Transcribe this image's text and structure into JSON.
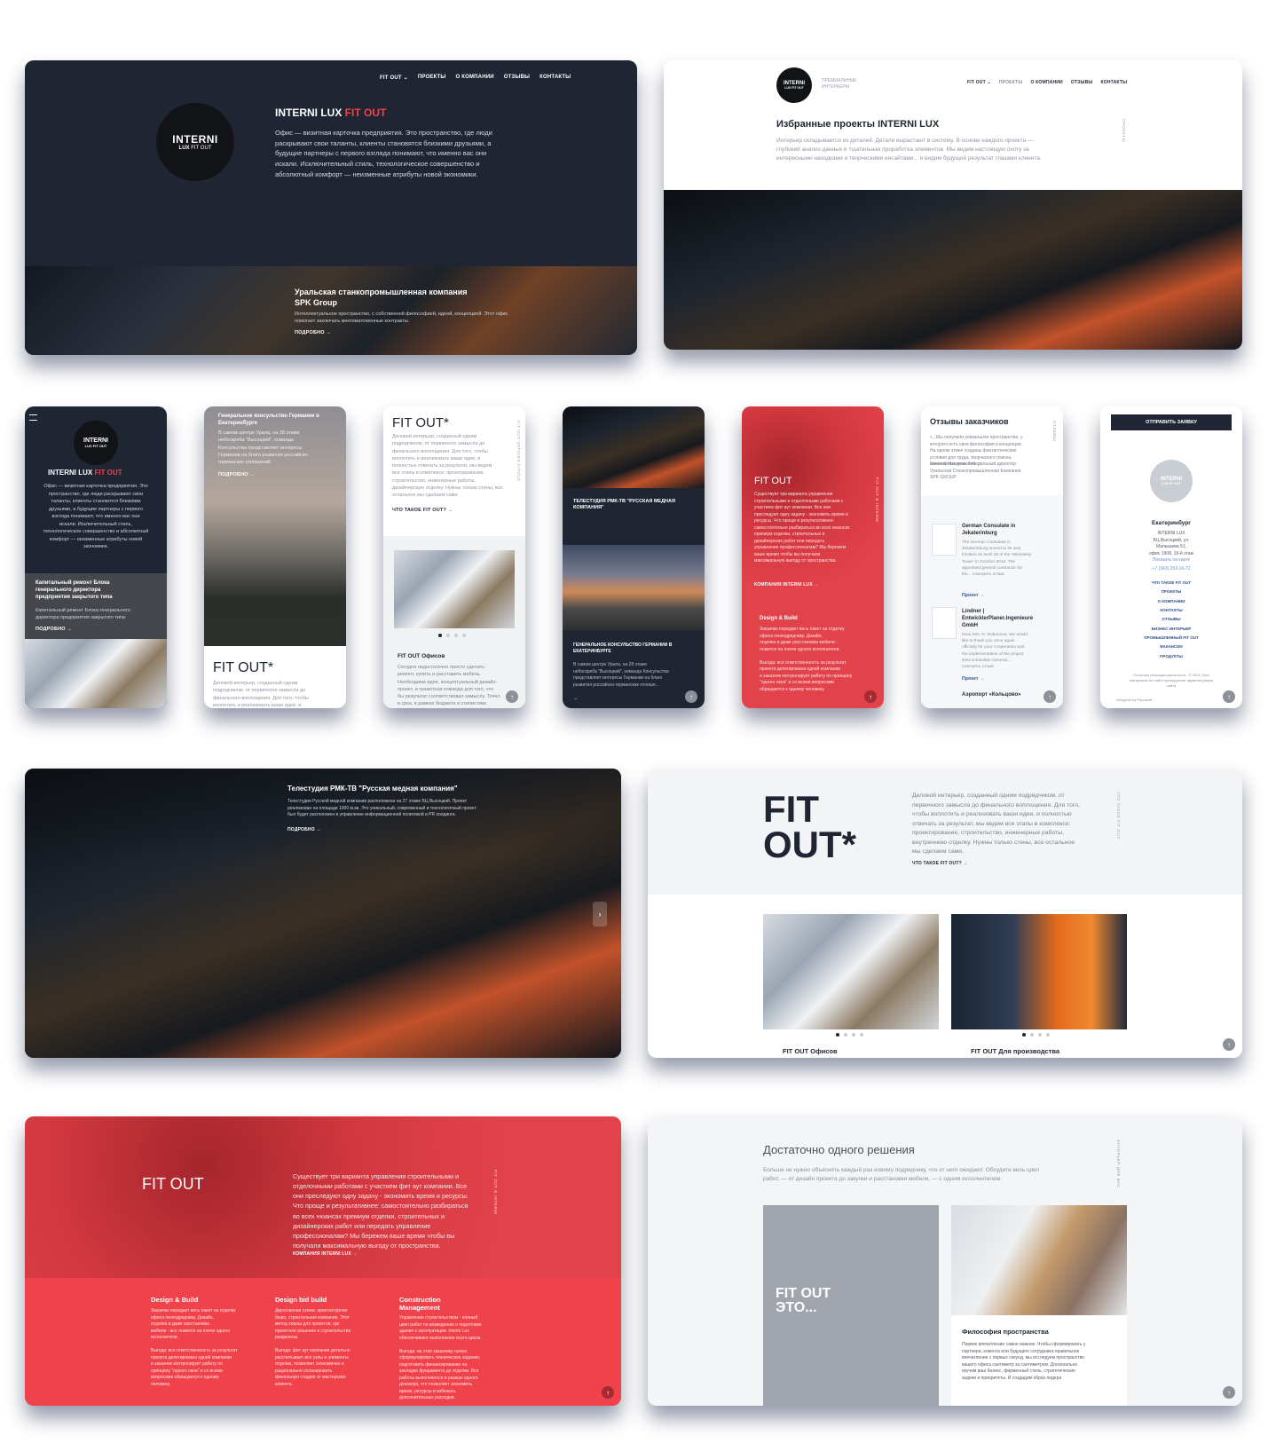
{
  "colors": {
    "navy": "#1f2533",
    "red": "#f0424b",
    "accent_red": "#e2434b"
  },
  "nav": {
    "fitout": "FIT OUT ⌄",
    "projects": "ПРОЕКТЫ",
    "company": "О КОМПАНИИ",
    "reviews": "ОТЗЫВЫ",
    "contacts": "КОНТАКТЫ",
    "fitout_plain": "FIT OUT ⌄"
  },
  "logo": {
    "top": "INTERNI",
    "bottom_lux": "LUX",
    "bottom_fit": "FIT OUT",
    "tagline": "ПРЕМИАЛЬНЫЕ\nИНТЕРЬЕРЫ"
  },
  "hero": {
    "title_white": "INTERNI LUX ",
    "title_red": "FIT OUT",
    "text": "Офис — визитная карточка предприятия. Это пространство, где люди\nраскрывают свои таланты, клиенты становятся близкими друзьями, а\nбудущие партнеры с первого взгляда понимают, что именно вас они\nискали. Исключительный стиль, технологическое совершенство и\nабсолютный комфорт — неизменные атрибуты новой экономики.",
    "slide_title": "Уральская станкопромышленная компания\nSPK Group",
    "slide_text": "Интеллектуальное пространство, с собственной философией, идеей, концепцией. Этот офис\nпомогает заключать многомиллионные контракты.",
    "slide_more": "ПОДРОБНО →"
  },
  "projects": {
    "title": "Избранные проекты INTERNI LUX",
    "text": "Интерьер складывается из деталей. Детали вырастают в систему. В основе каждого проекта —\nглубокий анализ данных и тщательная проработка элементов. Мы ведем настоящую охоту за\nинтересными находками и творческими инсайтами... и видим будущий результат глазами клиента.",
    "vert": "ПРОЕКТЫ"
  },
  "m1": {
    "title_white": "INTERNI LUX ",
    "title_red": "FIT OUT",
    "text": "Офис — визитная карточка предприятия. Это\nпространство, где люди раскрывают свои\nталанты, клиенты становятся близкими\nдрузьями, а будущие партнеры с первого\nвзгляда понимают, что именно вас они\nискали. Исключительный стиль,\nтехнологическое совершенство и абсолютный\nкомфорт — неизменные атрибуты новой\nэкономики.",
    "slide_title": "Капитальный ремонт Блока\nгенерального директора\nпредприятия закрытого типа",
    "slide_text": "Капитальный ремонт Блока генерального\nдиректора предприятия закрытого типа",
    "more": "ПОДРОБНО →"
  },
  "m2": {
    "title": "Генеральное консульство Германии в\nЕкатеринбурге",
    "text": "В самом центре Урала, на 28 этаже\nнебоскреба \"Высоцкий\", команда\nКонсульства представляет интересы\nГермании на благо развития российско-\nгерманских отношений.",
    "more": "ПОДРОБНО →",
    "big": "FIT OUT*",
    "bottom_text": "Деловой интерьер, созданный одним\nподрядчиком, от первичного замысла до\nфинального воплощения. Для того, чтобы\nвоплотить и реализовать ваши идеи, и"
  },
  "m3": {
    "big": "FIT OUT*",
    "text": "Деловой интерьер, созданный одним\nподрядчиком, от первичного замысла до\nфинального воплощения. Для того, чтобы\nвоплотить и реализовать ваши идеи, и\nполностью отвечать за результат, мы ведем\nвсе этапы в комплексе: проектирование,\nстроительство, инженерные работы,\nдизайнерскую отделку. Нужны только стены, все\nостальное мы сделаем сами.",
    "more": "ЧТО ТАКОЕ FIT OUT? →",
    "card_title": "FIT OUT Офисов",
    "card_text": "Сегодня недостаточно просто сделать\nремонт, купить и расставить мебель.\nНеобходима идея, концептуальный дизайн-\nпроект, и грамотная команда для того, что\nбы результат соответствовал замыслу. Точно\nв срок, в рамках бюджета и стилистики\nклиента.",
    "vert": "FIT OUT OFFICES FITOUT"
  },
  "m4": {
    "title": "ТЕЛЕСТУДИЯ РМК-ТВ \"РУССКАЯ МЕДНАЯ\nКОМПАНИЯ\"",
    "title2": "ГЕНЕРАЛЬНОЕ КОНСУЛЬСТВО ГЕРМАНИИ В\nЕКАТЕРИНБУРГЕ",
    "text": "В самом центре Урала, на 28 этаже\nнебоскреба \"Высоцкий\", команда Консульства\nпредставляет интересы Германии на благо\nразвития российско-германских отноше...",
    "more": "→"
  },
  "m5": {
    "title": "FIT OUT",
    "text": "Существует три варианта управления\nстроительными и отделочными работами с\nучастием фит аут компании. Все они\nпреследуют одну задачу - экономить время и\nресурсы. Что проще и результативнее:\nсамостоятельно разбираться во всех нюансах\nпремиум отделки, строительных и\nдизайнерских работ или передать\nуправление профессионалам? Мы бережем\nваше время чтобы вы получали\nмаксимальную выгоду от пространства.",
    "more": "КОМПАНИЯ INTERNI LUX →",
    "sub": "Design & Build",
    "sub_text": "Заказчик передает весь пакет на отделку\nофиса генподрядчику. Дизайн,\nотделка и даже расстановка мебели -\nложится на плечи одного исполнителя.\n\nВыгода: вся ответственность за результат\nпроекта делегирована одной компании\nи заказчик контролирует работу по принципу\n\"одного окна\" и со всеми вопросами\nобращается к одному человеку.",
    "vert": "FIT OUT В INTERNI"
  },
  "m6": {
    "title": "Отзывы заказчиков",
    "quote": "«...Мы получили уникальное пространство, у\nкоторого есть своя философия и концепция.\nНа одном этаже созданы фантастические\nусловия для труда, творческого поиска,\nинженерных решений...»",
    "author": "Евгений Макаров, Генеральный директор\nУральская Станкопромышленная Компания\nSPK GROUP",
    "r1_title": "German Consulate in\nJekaterinburg",
    "r1_text": "The German Consulate in\nJekaterinburg moved to its new\nlocation on level 28 of the 'Wissotsky\nTower' in October 2016. The\nappointed general contractor for\nthe... Смотреть отзыв",
    "r1_link": "Проект →",
    "r2_title": "Lindner |\nEntwicklerPlaner.Ingenieure\nGmbH",
    "r2_text": "Dear Mrs. N. Rubanova, We would\nlike to thank you once again\nofficially for your cooperation and\nthe implementation of the project\nNew Consulate General...\nСмотреть отзыв",
    "r2_link": "Проект →",
    "r3_title": "Аэропорт «Кольцово»",
    "vert": "ОТЗЫВЫ"
  },
  "m7": {
    "button": "ОТПРАВИТЬ ЗАЯВКУ",
    "city": "Екатеринбург",
    "addr": "INTERNI LUX\nБЦ Высоцкий, ул.\nМалышева 51,\nофис 1908, 19-й этаж",
    "map": "Показать на карте",
    "phone": "+7 (343) 253-16-72",
    "links": [
      "ЧТО ТАКОЕ FIT OUT",
      "ПРОЕКТЫ",
      "О КОМПАНИИ",
      "КОНТАКТЫ",
      "ОТЗЫВЫ",
      "БИЗНЕС ИНТЕРЬЕР",
      "ПРОМЫШЛЕННЫЙ FIT OUT",
      "ВАКАНСИИ",
      "ПРОДУКТЫ"
    ],
    "policy": "Политика конфиденциальности · © 2021 | Все\nматериалы на сайте принадлежат администрации\nсайта",
    "dev": "Designed by Pepelsoft"
  },
  "studio": {
    "title": "Телестудия РМК-ТВ \"Русская медная компания\"",
    "text": "Телестудия Русской медной компании расположена на 27 этаже БЦ Высоцкий. Проект\nреализован на площади 1000 м.кв. Это уникальный, современный и технологичный проект\nбыл будет расположен в управление информационной политикой и PR холдинга.",
    "more": "ПОДРОБНО →"
  },
  "fit": {
    "big": "FIT\nOUT*",
    "text": "Деловой интерьер, созданный одним подрядчиком, от\nпервичного замысла до финального воплощения. Для того,\nчтобы воплотить и реализовать ваши идеи, и полностью\nотвечать за результат, мы ведем все этапы в комплексе:\nпроектирование, строительство, инженерные работы,\nвнутреннюю отделку. Нужны только стены, все остальное\nмы сделаем сами.",
    "more": "ЧТО ТАКОЕ FIT OUT? →",
    "c1": "FIT OUT Офисов",
    "c2": "FIT OUT Для производства",
    "vert": "ЧТО ТАКОЕ FIT OUT"
  },
  "red": {
    "title": "FIT OUT",
    "text": "Существует три варианта управления строительными и\nотделочными работами с участием фит аут компании. Все\nони преследуют одну задачу - экономить время и ресурсы.\nЧто проще и результативнее: самостоятельно разбираться\nво всех нюансах премиум отделки, строительных и\nдизайнерских работ или передать управление\nпрофессионалам? Мы бережем ваше время чтобы вы\nполучали максимальную выгоду от пространства.",
    "more": "КОМПАНИЯ INTERNI LUX →",
    "vert": "FIT OUT В INTERNI",
    "cols": [
      {
        "title": "Design & Build",
        "text": "Заказчик передает весь пакет на отделку\nофиса генподрядчику. Дизайн,\nотделка и даже расстановка\nмебели - все ложится на плечи одного\nисполнителя.\n\nВыгода: вся ответственность за результат\nпроекта делегирована одной компании\nи заказчик контролирует работу по\nпринципу \"одного окна\" и со всеми\nвопросами обращается к одному\nчеловеку."
      },
      {
        "title": "Design bid build",
        "text": "Двухэтапная схема: архитектурное\nбюро, строительная компания. Этот\nметод хорош для проектов, где\nпроектное решение и строительство\nразделены.\n\nВыгода: фит аут компания детально\nрассчитывает все узлы и элементы\nотделки, позволяет экономично и\nрационально спланировать\nфинальную стадию от мастерских\nклиента."
      },
      {
        "title": "Construction\nManagement",
        "text": "Управление строительством - полный\nцикл работ по возведению и подготовке\nздания к эксплуатации. Interni Lux\nобеспечивают выполнение всего цикла.\n\nВыгода: на этап заказчику нужно\nсформулировать техническое задание,\nподготовить финансирование на\nзакладке фундамента до отделки. Все\nработы выполняются в рамках одного\nдоговора, что позволяет экономить\nвремя, ресурсы и избежать\nдополнительных расходов."
      }
    ]
  },
  "solution": {
    "title": "Достаточно одного решения",
    "text": "Больше не нужно объяснять каждый раз новому подрядчику, что от него ожидают. Обсудите весь цикл\nработ, — от дизайн проекта до закупки и расстановки мебели, — с одним исполнителем.",
    "grey": "FIT OUT\nЭТО...",
    "card_title": "Философия пространства",
    "card_text": "Первое впечатление самое важное. Чтобы сформировать у\nпартнера, клиента или будущего сотрудника правильное\nвпечатление с первых секунд, мы исследуем пространство\nвашего офиса сантиметр за сантиметром. Досконально\nизучим ваш бизнес, фирменный стиль, стратегические\nзадачи и приоритеты. И создадим образ лидера",
    "vert": "ИНТЕРЬЕР ДЛЯ ВАС"
  }
}
